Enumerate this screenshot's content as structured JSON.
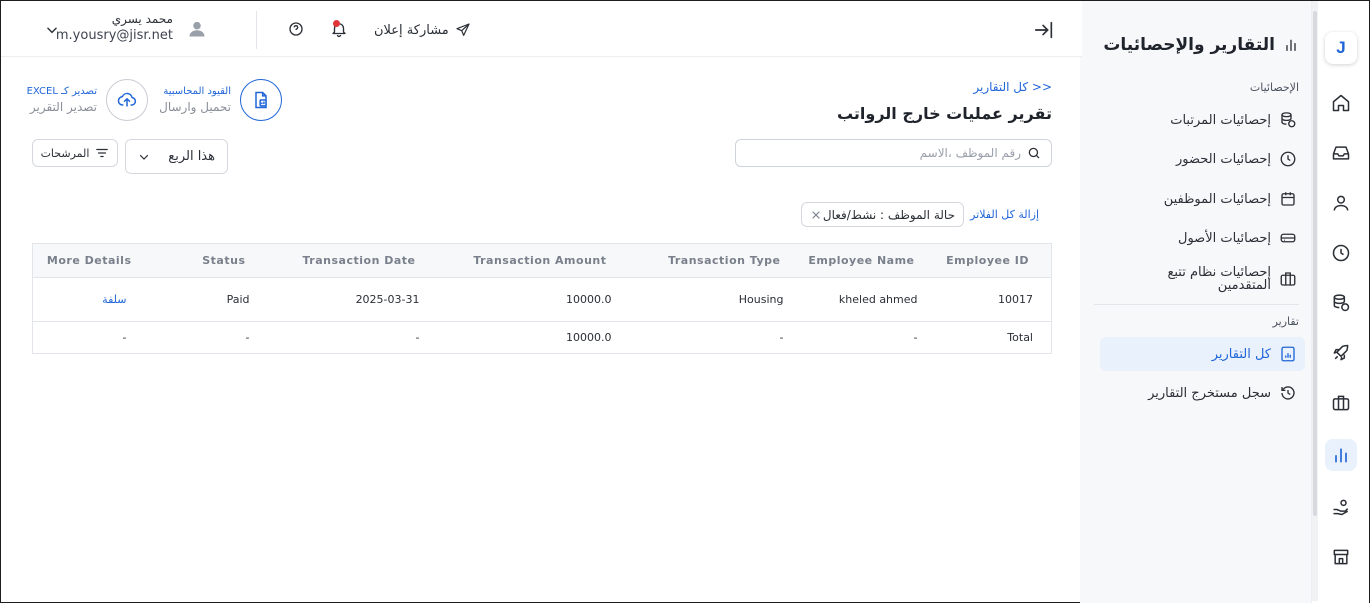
{
  "rail": {
    "logo": "J",
    "accent": "#2166d8"
  },
  "sidebar": {
    "title": "التقارير والإحصائيات",
    "stats_section": "الإحصائيات",
    "stats_items": [
      {
        "label": "إحصائيات المرتبات",
        "icon": "coins-icon"
      },
      {
        "label": "إحصائيات الحضور",
        "icon": "clock-icon"
      },
      {
        "label": "إحصائيات الموظفين",
        "icon": "calendar-icon"
      },
      {
        "label": "إحصائيات الأصول",
        "icon": "drive-icon"
      },
      {
        "label_line1": "إحصائيات نظام تتبع",
        "label_line2": "المتقدمين",
        "icon": "briefcase-icon"
      }
    ],
    "reports_section": "تقارير",
    "report_items": [
      {
        "label": "كل التقارير",
        "icon": "report-icon"
      },
      {
        "label": "سجل مستخرج التقارير",
        "icon": "history-icon"
      }
    ]
  },
  "header": {
    "share_label": "مشاركة إعلان",
    "user_name": "محمد يسري",
    "user_email": "m.yousry@jisr.net"
  },
  "main": {
    "breadcrumb": "<< كل التقارير",
    "title": "تقرير عمليات خارج الرواتب",
    "actions": {
      "journal_top": "القيود المحاسبية",
      "journal_bottom": "تحميل وارسال",
      "export_top": "تصدير كـ EXCEL",
      "export_bottom": "تصدير التقرير"
    },
    "search_placeholder": "رقم الموظف ،الاسم",
    "period": "هذا الربع",
    "filters_label": "المرشحات",
    "clear_filters": "إزالة كل الفلاتر",
    "active_filter": "حالة الموظف : نشط/فعال"
  },
  "table": {
    "headers": [
      "Employee ID",
      "Employee Name",
      "Transaction Type",
      "Transaction Amount",
      "Transaction Date",
      "Status",
      "More Details"
    ],
    "rows": [
      [
        "10017",
        "kheled ahmed",
        "Housing",
        "10000.0",
        "2025-03-31",
        "Paid",
        "سلفة"
      ]
    ],
    "total_row": [
      "Total",
      "-",
      "-",
      "10000.0",
      "-",
      "-",
      "-"
    ]
  }
}
